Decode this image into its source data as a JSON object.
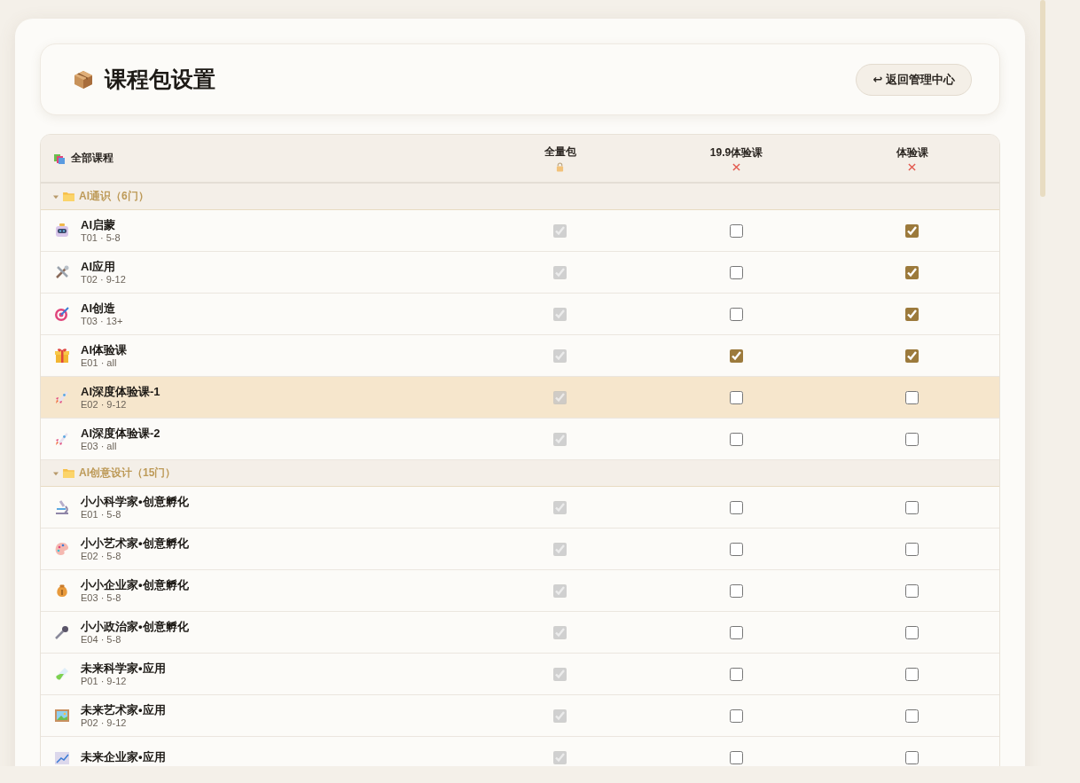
{
  "header": {
    "title": "课程包设置",
    "back_button": "↩ 返回管理中心"
  },
  "table": {
    "first_column": "全部课程",
    "columns": [
      {
        "label": "全量包",
        "kind": "locked"
      },
      {
        "label": "19.9体验课",
        "kind": "excluded"
      },
      {
        "label": "体验课",
        "kind": "excluded"
      }
    ],
    "groups": [
      {
        "label": "AI通识（6门）",
        "expanded": true,
        "rows": [
          {
            "name": "AI启蒙",
            "meta": "T01 · 5-8",
            "highlighted": false,
            "cells": [
              {
                "checked": true,
                "disabled": true
              },
              {
                "checked": false,
                "disabled": false
              },
              {
                "checked": true,
                "disabled": false
              }
            ]
          },
          {
            "name": "AI应用",
            "meta": "T02 · 9-12",
            "highlighted": false,
            "cells": [
              {
                "checked": true,
                "disabled": true
              },
              {
                "checked": false,
                "disabled": false
              },
              {
                "checked": true,
                "disabled": false
              }
            ]
          },
          {
            "name": "AI创造",
            "meta": "T03 · 13+",
            "highlighted": false,
            "cells": [
              {
                "checked": true,
                "disabled": true
              },
              {
                "checked": false,
                "disabled": false
              },
              {
                "checked": true,
                "disabled": false
              }
            ]
          },
          {
            "name": "AI体验课",
            "meta": "E01 · all",
            "highlighted": false,
            "cells": [
              {
                "checked": true,
                "disabled": true
              },
              {
                "checked": true,
                "disabled": false
              },
              {
                "checked": true,
                "disabled": false
              }
            ]
          },
          {
            "name": "AI深度体验课-1",
            "meta": "E02 · 9-12",
            "highlighted": true,
            "cells": [
              {
                "checked": true,
                "disabled": true
              },
              {
                "checked": false,
                "disabled": false
              },
              {
                "checked": false,
                "disabled": false
              }
            ]
          },
          {
            "name": "AI深度体验课-2",
            "meta": "E03 · all",
            "highlighted": false,
            "cells": [
              {
                "checked": true,
                "disabled": true
              },
              {
                "checked": false,
                "disabled": false
              },
              {
                "checked": false,
                "disabled": false
              }
            ]
          }
        ]
      },
      {
        "label": "AI创意设计（15门）",
        "expanded": true,
        "rows": [
          {
            "name": "小小科学家•创意孵化",
            "meta": "E01 · 5-8",
            "highlighted": false,
            "cells": [
              {
                "checked": true,
                "disabled": true
              },
              {
                "checked": false,
                "disabled": false
              },
              {
                "checked": false,
                "disabled": false
              }
            ]
          },
          {
            "name": "小小艺术家•创意孵化",
            "meta": "E02 · 5-8",
            "highlighted": false,
            "cells": [
              {
                "checked": true,
                "disabled": true
              },
              {
                "checked": false,
                "disabled": false
              },
              {
                "checked": false,
                "disabled": false
              }
            ]
          },
          {
            "name": "小小企业家•创意孵化",
            "meta": "E03 · 5-8",
            "highlighted": false,
            "cells": [
              {
                "checked": true,
                "disabled": true
              },
              {
                "checked": false,
                "disabled": false
              },
              {
                "checked": false,
                "disabled": false
              }
            ]
          },
          {
            "name": "小小政治家•创意孵化",
            "meta": "E04 · 5-8",
            "highlighted": false,
            "cells": [
              {
                "checked": true,
                "disabled": true
              },
              {
                "checked": false,
                "disabled": false
              },
              {
                "checked": false,
                "disabled": false
              }
            ]
          },
          {
            "name": "未来科学家•应用",
            "meta": "P01 · 9-12",
            "highlighted": false,
            "cells": [
              {
                "checked": true,
                "disabled": true
              },
              {
                "checked": false,
                "disabled": false
              },
              {
                "checked": false,
                "disabled": false
              }
            ]
          },
          {
            "name": "未来艺术家•应用",
            "meta": "P02 · 9-12",
            "highlighted": false,
            "cells": [
              {
                "checked": true,
                "disabled": true
              },
              {
                "checked": false,
                "disabled": false
              },
              {
                "checked": false,
                "disabled": false
              }
            ]
          },
          {
            "name": "未来企业家•应用",
            "highlighted": false,
            "cells": [
              {
                "checked": true,
                "disabled": true
              },
              {
                "checked": false,
                "disabled": false
              },
              {
                "checked": false,
                "disabled": false
              }
            ]
          }
        ]
      }
    ]
  }
}
